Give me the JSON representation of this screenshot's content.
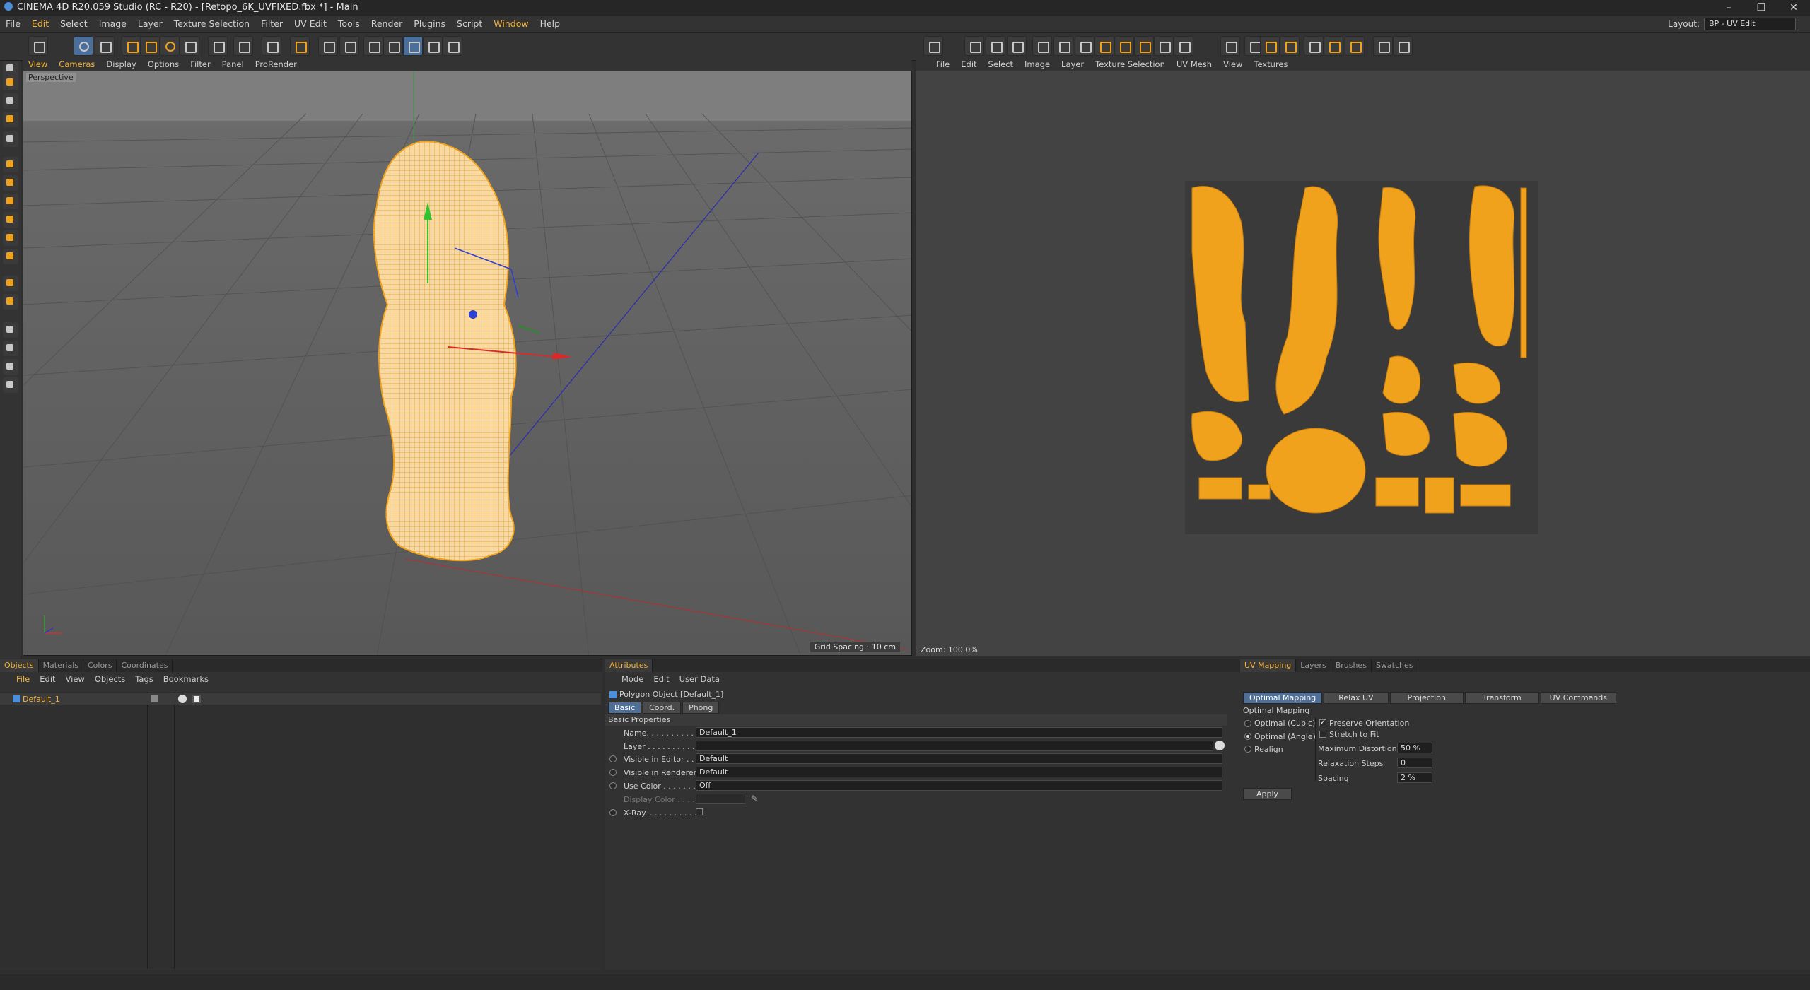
{
  "window": {
    "title": "CINEMA 4D R20.059 Studio (RC - R20) - [Retopo_6K_UVFIXED.fbx *] - Main"
  },
  "menubar": {
    "items": [
      "File",
      "Edit",
      "Select",
      "Image",
      "Layer",
      "Texture Selection",
      "Filter",
      "UV Edit",
      "Tools",
      "Render",
      "Plugins",
      "Script",
      "Window",
      "Help"
    ],
    "layout_label": "Layout:",
    "layout_value": "BP - UV Edit"
  },
  "viewport": {
    "menu": [
      "View",
      "Cameras",
      "Display",
      "Options",
      "Filter",
      "Panel",
      "ProRender"
    ],
    "camera_label": "Perspective",
    "grid_spacing": "Grid Spacing : 10 cm"
  },
  "uv_editor": {
    "menu": [
      "File",
      "Edit",
      "Select",
      "Image",
      "Layer",
      "Texture Selection",
      "UV Mesh",
      "View",
      "Textures"
    ],
    "zoom": "Zoom: 100.0%"
  },
  "objects_panel": {
    "tabs": [
      "Objects",
      "Materials",
      "Colors",
      "Coordinates"
    ],
    "menu": [
      "File",
      "Edit",
      "View",
      "Objects",
      "Tags",
      "Bookmarks"
    ],
    "object_name": "Default_1"
  },
  "attributes_panel": {
    "tab": "Attributes",
    "menu": [
      "Mode",
      "Edit",
      "User Data"
    ],
    "object_title": "Polygon Object [Default_1]",
    "subtabs": [
      "Basic",
      "Coord.",
      "Phong"
    ],
    "section": "Basic Properties",
    "fields": {
      "name_label": "Name. . . . . . . . . . . .",
      "name_value": "Default_1",
      "layer_label": "Layer . . . . . . . . . . .",
      "vis_editor_label": "Visible in Editor . . .",
      "vis_editor_value": "Default",
      "vis_render_label": "Visible in Renderer",
      "vis_render_value": "Default",
      "use_color_label": "Use Color . . . . . . . .",
      "use_color_value": "Off",
      "display_color_label": "Display Color . . . . .",
      "xray_label": "X-Ray. . . . . . . . . . ."
    }
  },
  "uv_mapping_panel": {
    "tabs": [
      "UV Mapping",
      "Layers",
      "Brushes",
      "Swatches"
    ],
    "subtabs": [
      "Optimal Mapping",
      "Relax UV",
      "Projection",
      "Transform",
      "UV Commands"
    ],
    "section": "Optimal Mapping",
    "options": [
      "Optimal (Cubic)",
      "Optimal (Angle)",
      "Realign"
    ],
    "checks": [
      "Preserve Orientation",
      "Stretch to Fit"
    ],
    "max_distortion_label": "Maximum Distortion",
    "max_distortion_value": "50 %",
    "relaxation_label": "Relaxation Steps",
    "relaxation_value": "0",
    "spacing_label": "Spacing",
    "spacing_value": "2 %",
    "apply_label": "Apply"
  },
  "colors": {
    "accent": "#f3b33a",
    "mesh": "#f2a81f",
    "uv_island": "#f0a21c"
  }
}
